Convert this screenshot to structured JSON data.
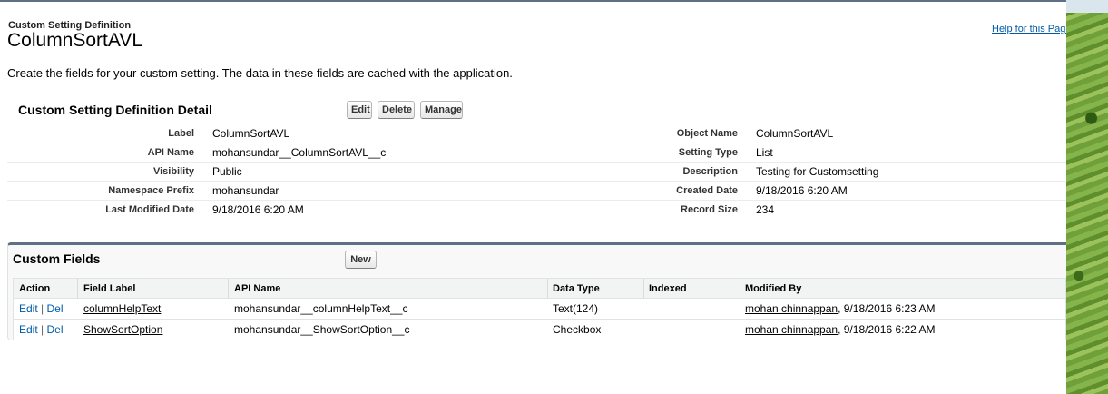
{
  "header": {
    "breadcrumb": "Custom Setting Definition",
    "title": "ColumnSortAVL",
    "help_link": "Help for this Page",
    "intro": "Create the fields for your custom setting. The data in these fields are cached with the application."
  },
  "detail": {
    "heading": "Custom Setting Definition Detail",
    "buttons": {
      "edit": "Edit",
      "delete": "Delete",
      "manage": "Manage"
    },
    "left": [
      {
        "label": "Label",
        "value": "ColumnSortAVL"
      },
      {
        "label": "API Name",
        "value": "mohansundar__ColumnSortAVL__c"
      },
      {
        "label": "Visibility",
        "value": "Public"
      },
      {
        "label": "Namespace Prefix",
        "value": "mohansundar"
      },
      {
        "label": "Last Modified Date",
        "value": "9/18/2016 6:20 AM"
      }
    ],
    "right": [
      {
        "label": "Object Name",
        "value": "ColumnSortAVL"
      },
      {
        "label": "Setting Type",
        "value": "List"
      },
      {
        "label": "Description",
        "value": "Testing for Customsetting"
      },
      {
        "label": "Created Date",
        "value": "9/18/2016 6:20 AM"
      },
      {
        "label": "Record Size",
        "value": "234"
      }
    ]
  },
  "custom_fields": {
    "heading": "Custom Fields",
    "new_button": "New",
    "columns": [
      "Action",
      "Field Label",
      "API Name",
      "Data Type",
      "Indexed",
      "Modified By"
    ],
    "action_edit": "Edit",
    "action_sep": "|",
    "action_del": "Del",
    "rows": [
      {
        "field_label": "columnHelpText",
        "api_name": "mohansundar__columnHelpText__c",
        "data_type": "Text(124)",
        "indexed": "",
        "modified_by": "mohan chinnappan",
        "modified_date": ", 9/18/2016 6:23 AM"
      },
      {
        "field_label": "ShowSortOption",
        "api_name": "mohansundar__ShowSortOption__c",
        "data_type": "Checkbox",
        "indexed": "",
        "modified_by": "mohan chinnappan",
        "modified_date": ", 9/18/2016 6:22 AM"
      }
    ]
  }
}
